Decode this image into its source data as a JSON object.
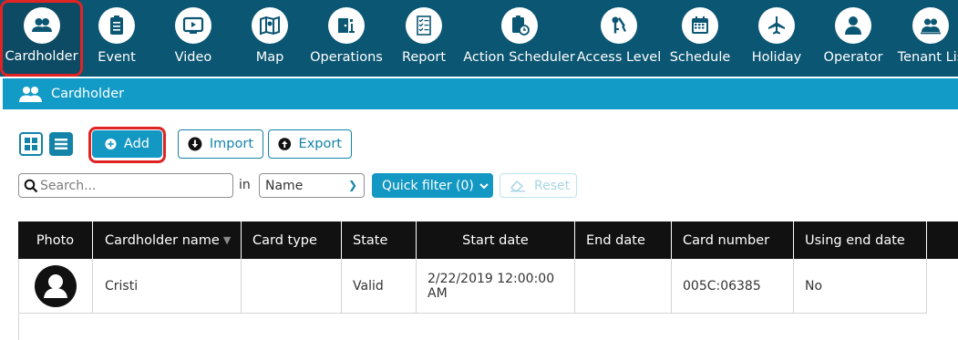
{
  "nav": {
    "items": [
      {
        "label": "Cardholder",
        "icon": "cardholder-icon"
      },
      {
        "label": "Event",
        "icon": "event-icon"
      },
      {
        "label": "Video",
        "icon": "video-icon"
      },
      {
        "label": "Map",
        "icon": "map-icon"
      },
      {
        "label": "Operations",
        "icon": "operations-icon"
      },
      {
        "label": "Report",
        "icon": "report-icon"
      },
      {
        "label": "Action Scheduler",
        "icon": "action-scheduler-icon"
      },
      {
        "label": "Access Level",
        "icon": "access-level-icon"
      },
      {
        "label": "Schedule",
        "icon": "calendar-icon"
      },
      {
        "label": "Holiday",
        "icon": "airplane-icon"
      },
      {
        "label": "Operator",
        "icon": "operator-icon"
      },
      {
        "label": "Tenant Lis",
        "icon": "tenant-list-icon"
      }
    ],
    "active": "Cardholder"
  },
  "section": {
    "title": "Cardholder",
    "icon": "cardholder-icon"
  },
  "toolbar": {
    "add_label": "Add",
    "import_label": "Import",
    "export_label": "Export"
  },
  "search": {
    "placeholder": "Search...",
    "in_label": "in",
    "field_selected": "Name",
    "quick_filter_label": "Quick filter (0)",
    "reset_label": "Reset"
  },
  "table": {
    "columns": [
      "Photo",
      "Cardholder name",
      "Card type",
      "State",
      "Start date",
      "End date",
      "Card number",
      "Using end date"
    ],
    "rows": [
      {
        "photo": "avatar-icon",
        "name": "Cristi",
        "card_type": "",
        "state": "Valid",
        "start_date": "2/22/2019 12:00:00 AM",
        "end_date": "",
        "card_number": "005C:06385",
        "using_end_date": "No"
      }
    ]
  },
  "colors": {
    "nav_bg": "#0b5672",
    "section_bar": "#119bc6",
    "accent": "#1398c3",
    "highlight": "#e02424",
    "table_header": "#111111"
  }
}
